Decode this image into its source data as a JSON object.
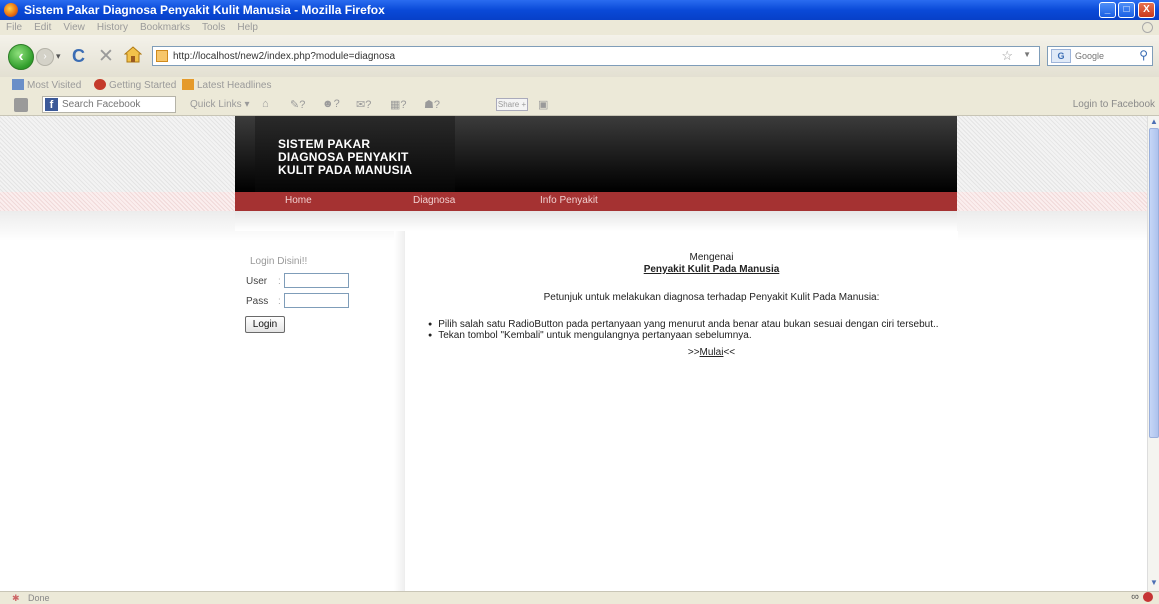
{
  "window": {
    "title": "Sistem Pakar Diagnosa Penyakit Kulit Manusia - Mozilla Firefox",
    "min_label": "_",
    "max_label": "□",
    "close_label": "X"
  },
  "menubar": [
    "File",
    "Edit",
    "View",
    "History",
    "Bookmarks",
    "Tools",
    "Help"
  ],
  "navbar": {
    "url": "http://localhost/new2/index.php?module=diagnosa",
    "search_engine": "Google"
  },
  "bookmarks": [
    "Most Visited",
    "Getting Started",
    "Latest Headlines"
  ],
  "fbtoolbar": {
    "search_placeholder": "Search Facebook",
    "quick_links": "Quick Links",
    "share_label": "Share",
    "login_label": "Login to Facebook"
  },
  "site": {
    "title_line1": "SISTEM PAKAR",
    "title_line2": "DIAGNOSA PENYAKIT",
    "title_line3": "KULIT PADA MANUSIA",
    "nav": [
      "Home",
      "Diagnosa",
      "Info Penyakit"
    ]
  },
  "login": {
    "heading": "Login Disini!!",
    "user_label": "User",
    "pass_label": "Pass",
    "button_label": "Login"
  },
  "content": {
    "heading": "Mengenai",
    "subheading": "Penyakit Kulit Pada Manusia",
    "intro": "Petunjuk untuk melakukan diagnosa terhadap Penyakit Kulit Pada Manusia:",
    "instructions": [
      "Pilih salah satu RadioButton pada pertanyaan yang menurut anda benar atau bukan sesuai dengan ciri tersebut..",
      "Tekan tombol \"Kembali\" untuk mengulangnya pertanyaan sebelumnya."
    ],
    "start_prefix": ">>",
    "start_link": "Mulai",
    "start_suffix": "<<"
  },
  "status": {
    "text": "Done"
  },
  "colors": {
    "nav_red": "#a53232",
    "header_dark": "#111111",
    "titlebar_blue": "#0a4ad8"
  }
}
